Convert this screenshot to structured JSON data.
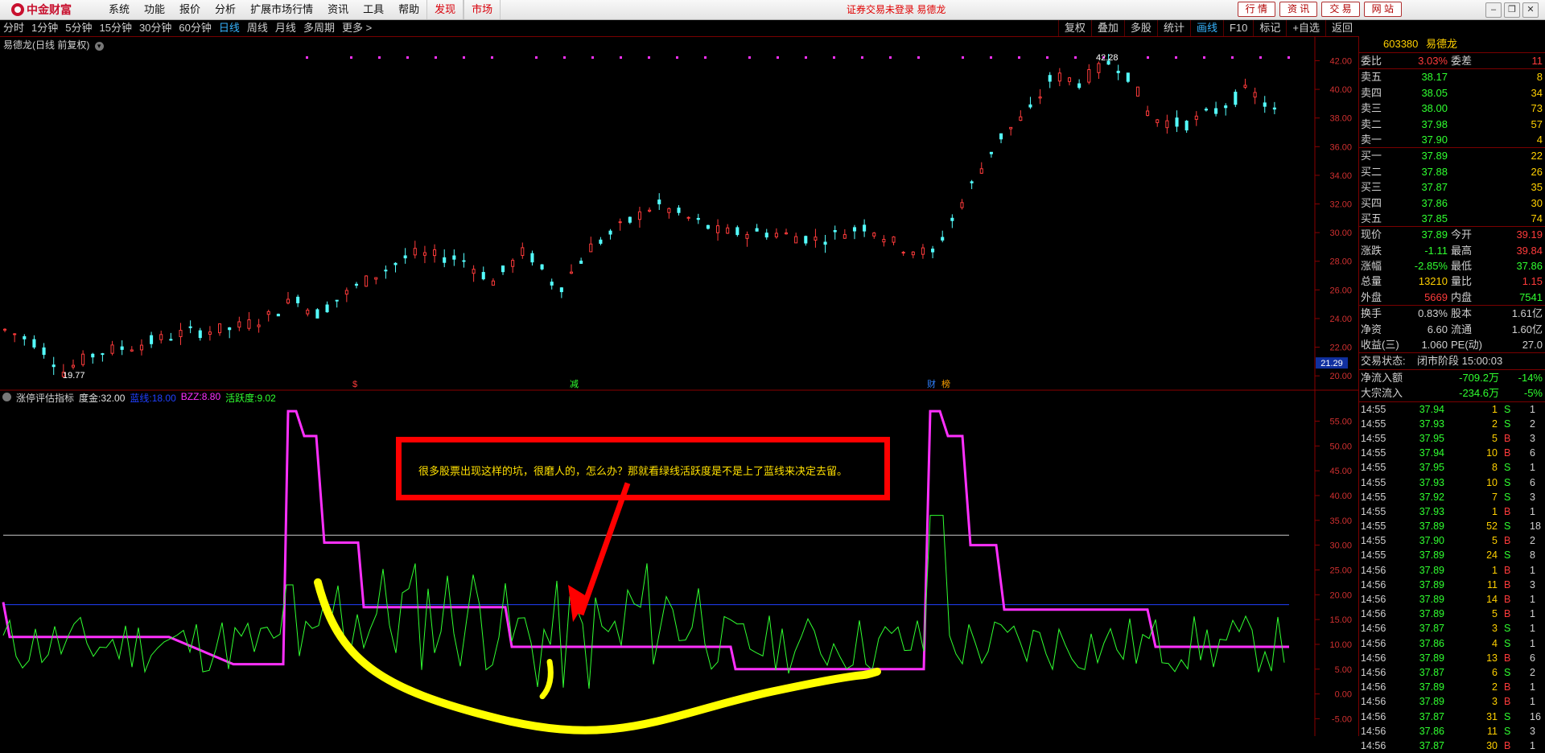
{
  "app": {
    "logo_text": "中金财富",
    "menu": [
      "系统",
      "功能",
      "报价",
      "分析",
      "扩展市场行情",
      "资讯",
      "工具",
      "帮助"
    ],
    "menu_red": [
      "发现",
      "市场"
    ],
    "notice": "证券交易未登录  易德龙",
    "top_buttons": [
      "行 情",
      "资 讯",
      "交 易",
      "网 站"
    ],
    "window_icons": [
      "minimize-icon",
      "restore-icon",
      "close-icon"
    ]
  },
  "toolbar": {
    "periods": [
      "分时",
      "1分钟",
      "5分钟",
      "15分钟",
      "30分钟",
      "60分钟",
      "日线",
      "周线",
      "月线",
      "多周期",
      "更多 >"
    ],
    "active_period": "日线",
    "right_tools": [
      "复权",
      "叠加",
      "多股",
      "统计",
      "画线",
      "F10",
      "标记",
      "+自选",
      "返回"
    ],
    "active_tool": "画线"
  },
  "chart": {
    "title": "易德龙(日线 前复权)",
    "y_axis_labels": [
      "42.00",
      "40.00",
      "38.00",
      "36.00",
      "34.00",
      "32.00",
      "30.00",
      "28.00",
      "26.00",
      "24.00",
      "22.00",
      "20.00"
    ],
    "current_price_tag": "21.29",
    "high_label": "42.28",
    "low_label": "19.77",
    "event_marks": [
      "$",
      "减",
      "财",
      "榜"
    ]
  },
  "indicator": {
    "name": "涨停评估指标",
    "params": [
      {
        "label": "度金:",
        "value": "32.00",
        "color": "#e0e0e0"
      },
      {
        "label": "蓝线:",
        "value": "18.00",
        "color": "#2040ff"
      },
      {
        "label": "BZZ:",
        "value": "8.80",
        "color": "#ff30ff"
      },
      {
        "label": "活跃度:",
        "value": "9.02",
        "color": "#30ff30"
      }
    ],
    "y_axis_labels": [
      "55.00",
      "50.00",
      "45.00",
      "40.00",
      "35.00",
      "30.00",
      "25.00",
      "20.00",
      "15.00",
      "10.00",
      "5.00",
      "0.00",
      "-5.00"
    ],
    "annotation": "很多股票出现这样的坑，很磨人的，怎么办？那就看绿线活跃度是不是上了蓝线来决定去留。"
  },
  "quote": {
    "code": "603380",
    "name": "易德龙",
    "webi": {
      "label": "委比",
      "value": "3.03%",
      "label2": "委差",
      "value2": "11"
    },
    "asks": [
      {
        "label": "卖五",
        "price": "38.17",
        "vol": "8"
      },
      {
        "label": "卖四",
        "price": "38.05",
        "vol": "34"
      },
      {
        "label": "卖三",
        "price": "38.00",
        "vol": "73"
      },
      {
        "label": "卖二",
        "price": "37.98",
        "vol": "57"
      },
      {
        "label": "卖一",
        "price": "37.90",
        "vol": "4"
      }
    ],
    "bids": [
      {
        "label": "买一",
        "price": "37.89",
        "vol": "22"
      },
      {
        "label": "买二",
        "price": "37.88",
        "vol": "26"
      },
      {
        "label": "买三",
        "price": "37.87",
        "vol": "35"
      },
      {
        "label": "买四",
        "price": "37.86",
        "vol": "30"
      },
      {
        "label": "买五",
        "price": "37.85",
        "vol": "74"
      }
    ],
    "stats": [
      {
        "l": "现价",
        "v": "37.89",
        "vc": "grn",
        "l2": "今开",
        "v2": "39.19",
        "v2c": "red"
      },
      {
        "l": "涨跌",
        "v": "-1.11",
        "vc": "grn",
        "l2": "最高",
        "v2": "39.84",
        "v2c": "red"
      },
      {
        "l": "涨幅",
        "v": "-2.85%",
        "vc": "grn",
        "l2": "最低",
        "v2": "37.86",
        "v2c": "grn"
      },
      {
        "l": "总量",
        "v": "13210",
        "vc": "yel",
        "l2": "量比",
        "v2": "1.15",
        "v2c": "red"
      },
      {
        "l": "外盘",
        "v": "5669",
        "vc": "red",
        "l2": "内盘",
        "v2": "7541",
        "v2c": "grn"
      }
    ],
    "stats2": [
      {
        "l": "换手",
        "v": "0.83%",
        "vc": "wht",
        "l2": "股本",
        "v2": "1.61亿",
        "v2c": "wht"
      },
      {
        "l": "净资",
        "v": "6.60",
        "vc": "wht",
        "l2": "流通",
        "v2": "1.60亿",
        "v2c": "wht"
      },
      {
        "l": "收益(三)",
        "v": "1.060",
        "vc": "wht",
        "l2": "PE(动)",
        "v2": "27.0",
        "v2c": "wht"
      }
    ],
    "trade_status": {
      "label": "交易状态:",
      "value": "闭市阶段 15:00:03"
    },
    "flows": [
      {
        "l": "净流入额",
        "v": "-709.2万",
        "p": "-14%"
      },
      {
        "l": "大宗流入",
        "v": "-234.6万",
        "p": "-5%"
      }
    ],
    "ticks": [
      [
        "14:55",
        "37.94",
        "1",
        "S",
        "1"
      ],
      [
        "14:55",
        "37.93",
        "2",
        "S",
        "2"
      ],
      [
        "14:55",
        "37.95",
        "5",
        "B",
        "3"
      ],
      [
        "14:55",
        "37.94",
        "10",
        "B",
        "6"
      ],
      [
        "14:55",
        "37.95",
        "8",
        "S",
        "1"
      ],
      [
        "14:55",
        "37.93",
        "10",
        "S",
        "6"
      ],
      [
        "14:55",
        "37.92",
        "7",
        "S",
        "3"
      ],
      [
        "14:55",
        "37.93",
        "1",
        "B",
        "1"
      ],
      [
        "14:55",
        "37.89",
        "52",
        "S",
        "18"
      ],
      [
        "14:55",
        "37.90",
        "5",
        "B",
        "2"
      ],
      [
        "14:55",
        "37.89",
        "24",
        "S",
        "8"
      ],
      [
        "14:56",
        "37.89",
        "1",
        "B",
        "1"
      ],
      [
        "14:56",
        "37.89",
        "11",
        "B",
        "3"
      ],
      [
        "14:56",
        "37.89",
        "14",
        "B",
        "1"
      ],
      [
        "14:56",
        "37.89",
        "5",
        "B",
        "1"
      ],
      [
        "14:56",
        "37.87",
        "3",
        "S",
        "1"
      ],
      [
        "14:56",
        "37.86",
        "4",
        "S",
        "1"
      ],
      [
        "14:56",
        "37.89",
        "13",
        "B",
        "6"
      ],
      [
        "14:56",
        "37.87",
        "6",
        "S",
        "2"
      ],
      [
        "14:56",
        "37.89",
        "2",
        "B",
        "1"
      ],
      [
        "14:56",
        "37.89",
        "3",
        "B",
        "1"
      ],
      [
        "14:56",
        "37.87",
        "31",
        "S",
        "16"
      ],
      [
        "14:56",
        "37.86",
        "11",
        "S",
        "3"
      ],
      [
        "14:56",
        "37.87",
        "30",
        "B",
        "1"
      ]
    ]
  },
  "colors": {
    "up": "#ff3b3b",
    "down": "#54ffff",
    "bzz": "#ff30ff",
    "active": "#30ff30",
    "blue_line": "#2040ff",
    "annot": "#ff0000",
    "marker": "#ffff00"
  }
}
